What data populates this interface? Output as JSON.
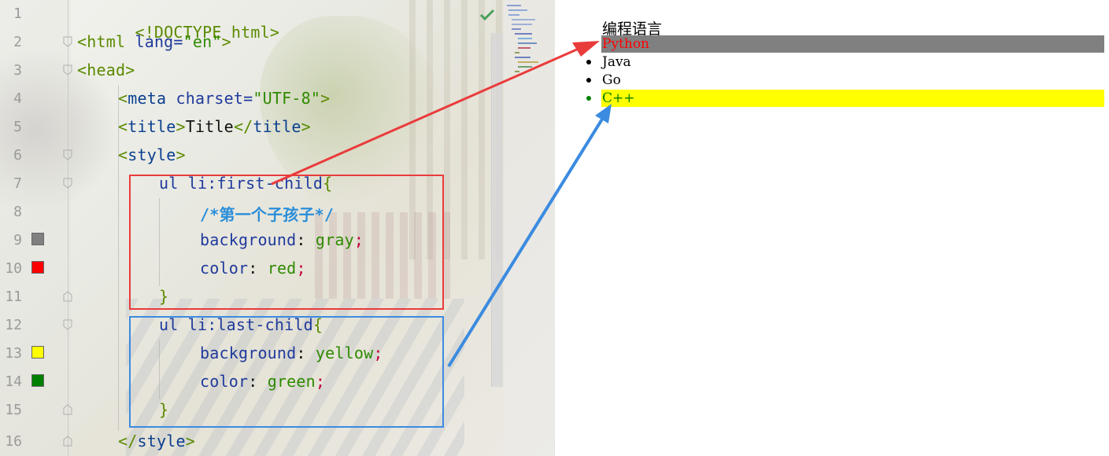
{
  "editor": {
    "lines": [
      {
        "n": "1"
      },
      {
        "n": "2"
      },
      {
        "n": "3"
      },
      {
        "n": "4"
      },
      {
        "n": "5"
      },
      {
        "n": "6"
      },
      {
        "n": "7"
      },
      {
        "n": "8"
      },
      {
        "n": "9"
      },
      {
        "n": "10"
      },
      {
        "n": "11"
      },
      {
        "n": "12"
      },
      {
        "n": "13"
      },
      {
        "n": "14"
      },
      {
        "n": "15"
      },
      {
        "n": "16"
      }
    ],
    "code": {
      "l1": "<!DOCTYPE html>",
      "l2_tag": "<html",
      "l2_attr": " lang=",
      "l2_str": "\"en\"",
      "l2_close": ">",
      "l3": "<head>",
      "l4_open": "<",
      "l4_tag": "meta",
      "l4_attr": " charset=",
      "l4_str": "\"UTF-8\"",
      "l4_close": ">",
      "l5_o1": "<",
      "l5_t1": "title",
      "l5_c1": ">",
      "l5_text": "Title",
      "l5_o2": "</",
      "l5_t2": "title",
      "l5_c2": ">",
      "l6_open": "<",
      "l6_tag": "style",
      "l6_close": ">",
      "l7_sel": "ul li:first-child",
      "l7_brace": "{",
      "l8_comment": "/*第一个子孩子*/",
      "l9_prop": "background",
      "l9_colon": ": ",
      "l9_val": "gray",
      "l9_semi": ";",
      "l10_prop": "color",
      "l10_colon": ": ",
      "l10_val": "red",
      "l10_semi": ";",
      "l11": "}",
      "l12_sel": "ul li:last-child",
      "l12_brace": "{",
      "l13_prop": "background",
      "l13_colon": ": ",
      "l13_val": "yellow",
      "l13_semi": ";",
      "l14_prop": "color",
      "l14_colon": ": ",
      "l14_val": "green",
      "l14_semi": ";",
      "l15": "}",
      "l16_open": "</",
      "l16_tag": "style",
      "l16_close": ">"
    },
    "swatches": {
      "gray": "#808080",
      "red": "#ff0000",
      "yellow": "#ffff00",
      "green": "#008000"
    },
    "status_icon": "check-icon",
    "annotation_colors": {
      "first": "#ea3b3b",
      "last": "#3b8be0"
    }
  },
  "preview": {
    "heading": "编程语言",
    "items": [
      {
        "label": "Python",
        "color": "#ff0000",
        "background": "#808080"
      },
      {
        "label": "Java",
        "color": "#000000",
        "background": ""
      },
      {
        "label": "Go",
        "color": "#000000",
        "background": ""
      },
      {
        "label": "C++",
        "color": "#008000",
        "background": "#ffff00"
      }
    ]
  }
}
